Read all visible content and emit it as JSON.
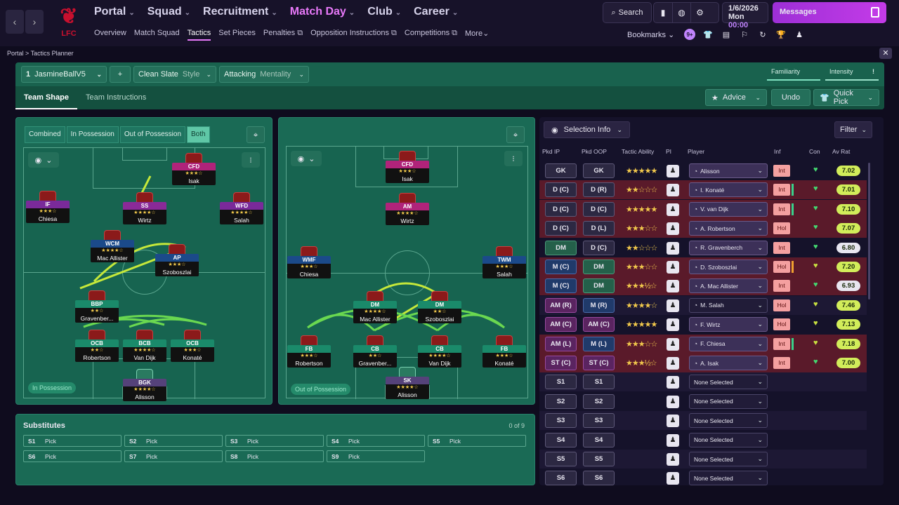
{
  "club": {
    "name": "LFC"
  },
  "nav": {
    "main": [
      {
        "label": "Portal",
        "active": false
      },
      {
        "label": "Squad",
        "active": false
      },
      {
        "label": "Recruitment",
        "active": false
      },
      {
        "label": "Match Day",
        "active": true
      },
      {
        "label": "Club",
        "active": false
      },
      {
        "label": "Career",
        "active": false
      }
    ],
    "sub": [
      "Overview",
      "Match Squad",
      "Tactics",
      "Set Pieces",
      "Penalties",
      "Opposition Instructions",
      "Competitions",
      "More"
    ],
    "search_label": "Search",
    "date": "1/6/2026",
    "day": "Mon",
    "time": "00:00",
    "messages_label": "Messages",
    "bookmarks_label": "Bookmarks",
    "bookmark_badge": "9+"
  },
  "breadcrumb": {
    "root": "Portal",
    "sep": ">",
    "current": "Tactics Planner"
  },
  "tactic": {
    "slot": "1",
    "name": "JasmineBallV5",
    "add": "+",
    "style_value": "Clean Slate",
    "style_label": "Style",
    "mentality_value": "Attacking",
    "mentality_label": "Mentality",
    "familiarity_label": "Familiarity",
    "intensity_label": "Intensity",
    "intensity_warning": "!",
    "tabs": [
      "Team Shape",
      "Team Instructions"
    ],
    "advice_label": "Advice",
    "undo_label": "Undo",
    "quickpick_label": "Quick Pick"
  },
  "pitch_in": {
    "tabs": [
      "Combined",
      "In Possession",
      "Out of Possession",
      "Both"
    ],
    "badge": "In Possession",
    "players": [
      {
        "role": "CFD",
        "stars": "★★★☆",
        "name": "Isak",
        "cls": "r-cfd"
      },
      {
        "role": "IF",
        "stars": "★★★☆",
        "name": "Chiesa",
        "cls": "r-if"
      },
      {
        "role": "SS",
        "stars": "★★★★☆",
        "name": "Wirtz",
        "cls": "r-ss"
      },
      {
        "role": "WFD",
        "stars": "★★★★☆",
        "name": "Salah",
        "cls": "r-wfd"
      },
      {
        "role": "WCM",
        "stars": "★★★★☆",
        "name": "Mac Allister",
        "cls": "r-wcm"
      },
      {
        "role": "AP",
        "stars": "★★★☆",
        "name": "Szoboszlai",
        "cls": "r-ap"
      },
      {
        "role": "BBP",
        "stars": "★★☆",
        "name": "Gravenber...",
        "cls": "r-bbp"
      },
      {
        "role": "OCB",
        "stars": "★★☆",
        "name": "Robertson",
        "cls": "r-ocb"
      },
      {
        "role": "BCB",
        "stars": "★★★★☆",
        "name": "Van Dijk",
        "cls": "r-bcb"
      },
      {
        "role": "OCB",
        "stars": "★★★☆",
        "name": "Konaté",
        "cls": "r-ocb"
      },
      {
        "role": "BGK",
        "stars": "★★★★☆",
        "name": "Alisson",
        "cls": "r-bgk"
      }
    ]
  },
  "pitch_out": {
    "badge": "Out of Possession",
    "players": [
      {
        "role": "CFD",
        "stars": "★★★☆",
        "name": "Isak",
        "cls": "r-cfd"
      },
      {
        "role": "AM",
        "stars": "★★★★☆",
        "name": "Wirtz",
        "cls": "r-am"
      },
      {
        "role": "WMF",
        "stars": "★★★☆",
        "name": "Chiesa",
        "cls": "r-wmf"
      },
      {
        "role": "TWM",
        "stars": "★★★☆",
        "name": "Salah",
        "cls": "r-twm"
      },
      {
        "role": "DM",
        "stars": "★★★★☆",
        "name": "Mac Allister",
        "cls": "r-dm"
      },
      {
        "role": "DM",
        "stars": "★★☆",
        "name": "Szoboszlai",
        "cls": "r-dm"
      },
      {
        "role": "FB",
        "stars": "★★★☆",
        "name": "Robertson",
        "cls": "r-fb"
      },
      {
        "role": "CB",
        "stars": "★★☆",
        "name": "Gravenber...",
        "cls": "r-cb"
      },
      {
        "role": "CB",
        "stars": "★★★★☆",
        "name": "Van Dijk",
        "cls": "r-cb"
      },
      {
        "role": "FB",
        "stars": "★★★☆",
        "name": "Konaté",
        "cls": "r-fb"
      },
      {
        "role": "SK",
        "stars": "★★★★☆",
        "name": "Alisson",
        "cls": "r-sk"
      }
    ]
  },
  "subs": {
    "title": "Substitutes",
    "count": "0 of 9",
    "slots": [
      {
        "id": "S1",
        "value": "Pick"
      },
      {
        "id": "S2",
        "value": "Pick"
      },
      {
        "id": "S3",
        "value": "Pick"
      },
      {
        "id": "S4",
        "value": "Pick"
      },
      {
        "id": "S5",
        "value": "Pick"
      },
      {
        "id": "S6",
        "value": "Pick"
      },
      {
        "id": "S7",
        "value": "Pick"
      },
      {
        "id": "S8",
        "value": "Pick"
      },
      {
        "id": "S9",
        "value": "Pick"
      }
    ]
  },
  "selection": {
    "title": "Selection Info",
    "filter": "Filter",
    "headers": [
      "Pkd IP",
      "Pkd OOP",
      "Tactic Ability",
      "PI",
      "Player",
      "Inf",
      "Con",
      "Av Rat"
    ],
    "rows": [
      {
        "ip": "GK",
        "oop": "GK",
        "ta": "★★★★★",
        "player": "Alisson",
        "inf": "Int",
        "con": "♥",
        "rat": "7.02",
        "ratw": false
      },
      {
        "ip": "D (C)",
        "oop": "D (R)",
        "ta": "★★☆☆☆",
        "player": "I. Konaté",
        "inf": "Int",
        "con": "♥",
        "rat": "7.01",
        "ratw": false
      },
      {
        "ip": "D (C)",
        "oop": "D (C)",
        "ta": "★★★★★",
        "player": "V. van Dijk",
        "inf": "Int",
        "con": "♥",
        "rat": "7.10",
        "ratw": false
      },
      {
        "ip": "D (C)",
        "oop": "D (L)",
        "ta": "★★★☆☆",
        "player": "A. Robertson",
        "inf": "Hol",
        "con": "♥",
        "rat": "7.07",
        "ratw": false
      },
      {
        "ip": "DM",
        "oop": "D (C)",
        "ta": "★★☆☆☆",
        "player": "R. Gravenberch",
        "inf": "Int",
        "con": "♥",
        "rat": "6.80",
        "ratw": true
      },
      {
        "ip": "M (C)",
        "oop": "DM",
        "ta": "★★★☆☆",
        "player": "D. Szoboszlai",
        "inf": "Hol",
        "con": "♥",
        "rat": "7.20",
        "ratw": false
      },
      {
        "ip": "M (C)",
        "oop": "DM",
        "ta": "★★★½☆",
        "player": "A. Mac Allister",
        "inf": "Int",
        "con": "♥",
        "rat": "6.93",
        "ratw": true
      },
      {
        "ip": "AM (R)",
        "oop": "M (R)",
        "ta": "★★★★☆",
        "player": "M. Salah",
        "inf": "Hol",
        "con": "♥",
        "rat": "7.46",
        "ratw": false
      },
      {
        "ip": "AM (C)",
        "oop": "AM (C)",
        "ta": "★★★★★",
        "player": "F. Wirtz",
        "inf": "Hol",
        "con": "♥",
        "rat": "7.13",
        "ratw": false
      },
      {
        "ip": "AM (L)",
        "oop": "M (L)",
        "ta": "★★★☆☆",
        "player": "F. Chiesa",
        "inf": "Int",
        "con": "♥",
        "rat": "7.18",
        "ratw": false
      },
      {
        "ip": "ST (C)",
        "oop": "ST (C)",
        "ta": "★★★½☆",
        "player": "A. Isak",
        "inf": "Int",
        "con": "♥",
        "rat": "7.00",
        "ratw": false
      }
    ],
    "subs": [
      {
        "ip": "S1",
        "oop": "S1",
        "player": "None Selected"
      },
      {
        "ip": "S2",
        "oop": "S2",
        "player": "None Selected"
      },
      {
        "ip": "S3",
        "oop": "S3",
        "player": "None Selected"
      },
      {
        "ip": "S4",
        "oop": "S4",
        "player": "None Selected"
      },
      {
        "ip": "S5",
        "oop": "S5",
        "player": "None Selected"
      },
      {
        "ip": "S6",
        "oop": "S6",
        "player": "None Selected"
      }
    ]
  }
}
